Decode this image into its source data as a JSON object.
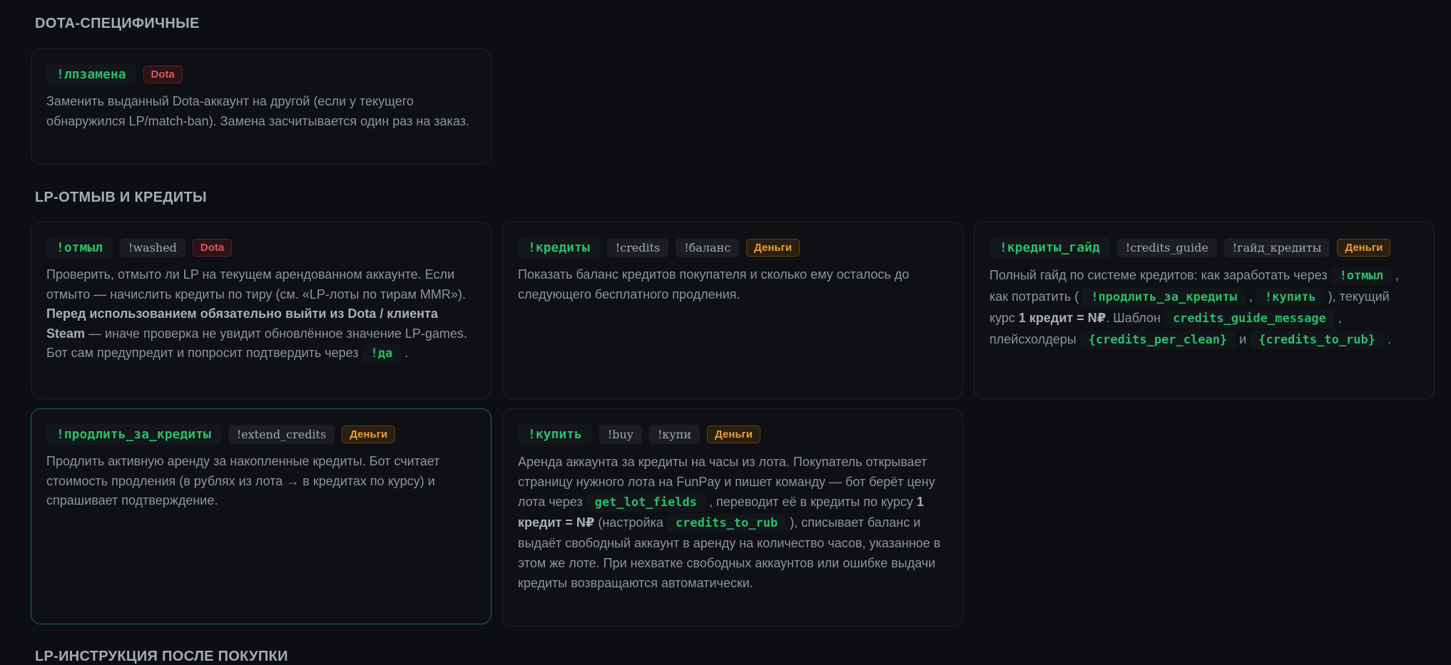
{
  "sections": {
    "dota": "DOTA-СПЕЦИФИЧНЫЕ",
    "lp": "LP-ОТМЫВ И КРЕДИТЫ",
    "instructions": "LP-ИНСТРУКЦИЯ ПОСЛЕ ПОКУПКИ"
  },
  "tags": {
    "dota": "Dota",
    "money": "Деньги"
  },
  "cards": {
    "lpzamena": {
      "command": "!лпзамена",
      "description": "Заменить выданный Dota-аккаунт на другой (если у текущего обнаружился LP/match-ban). Замена засчитывается один раз на заказ."
    },
    "otmyl": {
      "command": "!отмыл",
      "aliases": [
        "!washed"
      ],
      "desc_1": "Проверить, отмыто ли LP на текущем арендованном аккаунте. Если отмыто — начислить кредиты по тиру (см. «LP-лоты по тирам MMR»). ",
      "desc_bold": "Перед использованием обязательно выйти из Dota / клиента Steam",
      "desc_2": " — иначе проверка не увидит обновлённое значение LP-games. Бот сам предупредит и попросит подтвердить через ",
      "desc_code": "!да",
      "desc_3": " ."
    },
    "kredity": {
      "command": "!кредиты",
      "aliases": [
        "!credits",
        "!баланс"
      ],
      "description": "Показать баланс кредитов покупателя и сколько ему осталось до следующего бесплатного продления."
    },
    "kredity_guide": {
      "command": "!кредиты_гайд",
      "aliases": [
        "!credits_guide",
        "!гайд_кредиты"
      ],
      "d1": "Полный гайд по системе кредитов: как заработать через ",
      "c1": "!отмыл",
      "d2": " , как потратить ( ",
      "c2": "!продлить_за_кредиты",
      "d3": " , ",
      "c3": "!купить",
      "d4": " ), текущий курс ",
      "b1": "1 кредит = N₽",
      "d5": ". Шаблон ",
      "c4": "credits_guide_message",
      "d6": " , плейсхолдеры ",
      "c5": "{credits_per_clean}",
      "d7": " и ",
      "c6": "{credits_to_rub}",
      "d8": " ."
    },
    "prodlit": {
      "command": "!продлить_за_кредиты",
      "aliases": [
        "!extend_credits"
      ],
      "description": "Продлить активную аренду за накопленные кредиты. Бот считает стоимость продления (в рублях из лота → в кредитах по курсу) и спрашивает подтверждение."
    },
    "kupit": {
      "command": "!купить",
      "aliases": [
        "!buy",
        "!купи"
      ],
      "d1": "Аренда аккаунта за кредиты на часы из лота. Покупатель открывает страницу нужного лота на FunPay и пишет команду — бот берёт цену лота через ",
      "c1": "get_lot_fields",
      "d2": " , переводит её в кредиты по курсу ",
      "b1": "1 кредит = N₽",
      "d3": " (настройка ",
      "c2": "credits_to_rub",
      "d4": " ), списывает баланс и выдаёт свободный аккаунт в аренду на количество часов, указанное в этом же лоте. При нехватке свободных аккаунтов или ошибке выдачи кредиты возвращаются автоматически."
    }
  },
  "colors": {
    "background": "#0d0e12",
    "card_border": "#1f2228",
    "active_border": "#1d6b45",
    "command_green": "#2bbd6a",
    "dota_red": "#e0565e",
    "money_orange": "#e7a032"
  }
}
